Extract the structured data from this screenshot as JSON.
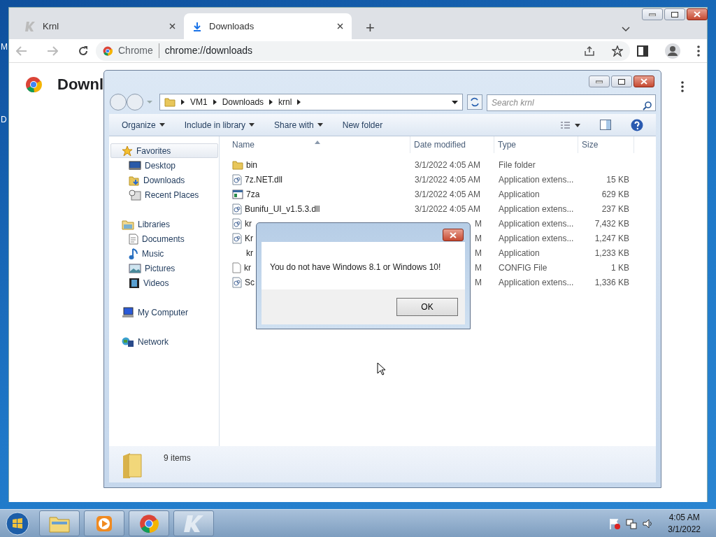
{
  "desktop": {
    "icon_labels": [
      "M",
      "D"
    ]
  },
  "browser": {
    "tabs": [
      {
        "title": "Krnl",
        "selected": false,
        "kind": "krnl"
      },
      {
        "title": "Downloads",
        "selected": true,
        "kind": "download"
      }
    ],
    "new_tab": "+",
    "omnibox": {
      "label": "Chrome",
      "url": "chrome://downloads"
    },
    "page_title": "Downl"
  },
  "explorer": {
    "breadcrumb": [
      "VM1",
      "Downloads",
      "krnl"
    ],
    "search": {
      "placeholder": "Search krnl"
    },
    "toolbar": [
      {
        "label": "Organize",
        "dropdown": true
      },
      {
        "label": "Include in library",
        "dropdown": true
      },
      {
        "label": "Share with",
        "dropdown": true
      },
      {
        "label": "New folder",
        "dropdown": false
      }
    ],
    "nav": [
      {
        "label": "Favorites",
        "kind": "star",
        "selected": true,
        "children": [
          {
            "label": "Desktop",
            "kind": "desktop",
            "selected": false
          },
          {
            "label": "Downloads",
            "kind": "downloads",
            "selected": false
          },
          {
            "label": "Recent Places",
            "kind": "recent",
            "selected": false
          }
        ]
      },
      {
        "label": "Libraries",
        "kind": "library",
        "selected": false,
        "children": [
          {
            "label": "Documents",
            "kind": "document",
            "selected": false
          },
          {
            "label": "Music",
            "kind": "music",
            "selected": false
          },
          {
            "label": "Pictures",
            "kind": "pictures",
            "selected": false
          },
          {
            "label": "Videos",
            "kind": "videos",
            "selected": false
          }
        ]
      },
      {
        "label": "My Computer",
        "kind": "computer",
        "selected": false
      },
      {
        "label": "Network",
        "kind": "network",
        "selected": false
      }
    ],
    "columns": [
      {
        "label": "Name",
        "sorted": true
      },
      {
        "label": "Date modified",
        "sorted": false
      },
      {
        "label": "Type",
        "sorted": false
      },
      {
        "label": "Size",
        "sorted": false
      }
    ],
    "rows": [
      {
        "name": "bin",
        "kind": "folder",
        "date": "3/1/2022 4:05 AM",
        "type": "File folder",
        "size": "",
        "covered": false
      },
      {
        "name": "7z.NET.dll",
        "kind": "dll",
        "date": "3/1/2022 4:05 AM",
        "type": "Application extens...",
        "size": "15 KB",
        "covered": false
      },
      {
        "name": "7za",
        "kind": "app",
        "date": "3/1/2022 4:05 AM",
        "type": "Application",
        "size": "629 KB",
        "covered": false
      },
      {
        "name": "Bunifu_UI_v1.5.3.dll",
        "kind": "dll",
        "date": "3/1/2022 4:05 AM",
        "type": "Application extens...",
        "size": "237 KB",
        "covered": false
      },
      {
        "name": "kr",
        "kind": "dll",
        "date": "M",
        "type": "Application extens...",
        "size": "7,432 KB",
        "covered": true
      },
      {
        "name": "Kr",
        "kind": "dll",
        "date": "M",
        "type": "Application extens...",
        "size": "1,247 KB",
        "covered": true
      },
      {
        "name": "kr",
        "kind": "none",
        "date": "M",
        "type": "Application",
        "size": "1,233 KB",
        "covered": true
      },
      {
        "name": "kr",
        "kind": "config",
        "date": "M",
        "type": "CONFIG File",
        "size": "1 KB",
        "covered": true
      },
      {
        "name": "Sc",
        "kind": "dll",
        "date": "M",
        "type": "Application extens...",
        "size": "1,336 KB",
        "covered": true
      }
    ],
    "status": "9 items"
  },
  "dialog": {
    "message": "You do not have Windows 8.1 or Windows 10!",
    "button": "OK"
  },
  "taskbar": {
    "apps": [
      {
        "kind": "explorer"
      },
      {
        "kind": "media"
      },
      {
        "kind": "chrome"
      },
      {
        "kind": "krnl"
      }
    ],
    "time": "4:05 AM",
    "date": "3/1/2022"
  }
}
